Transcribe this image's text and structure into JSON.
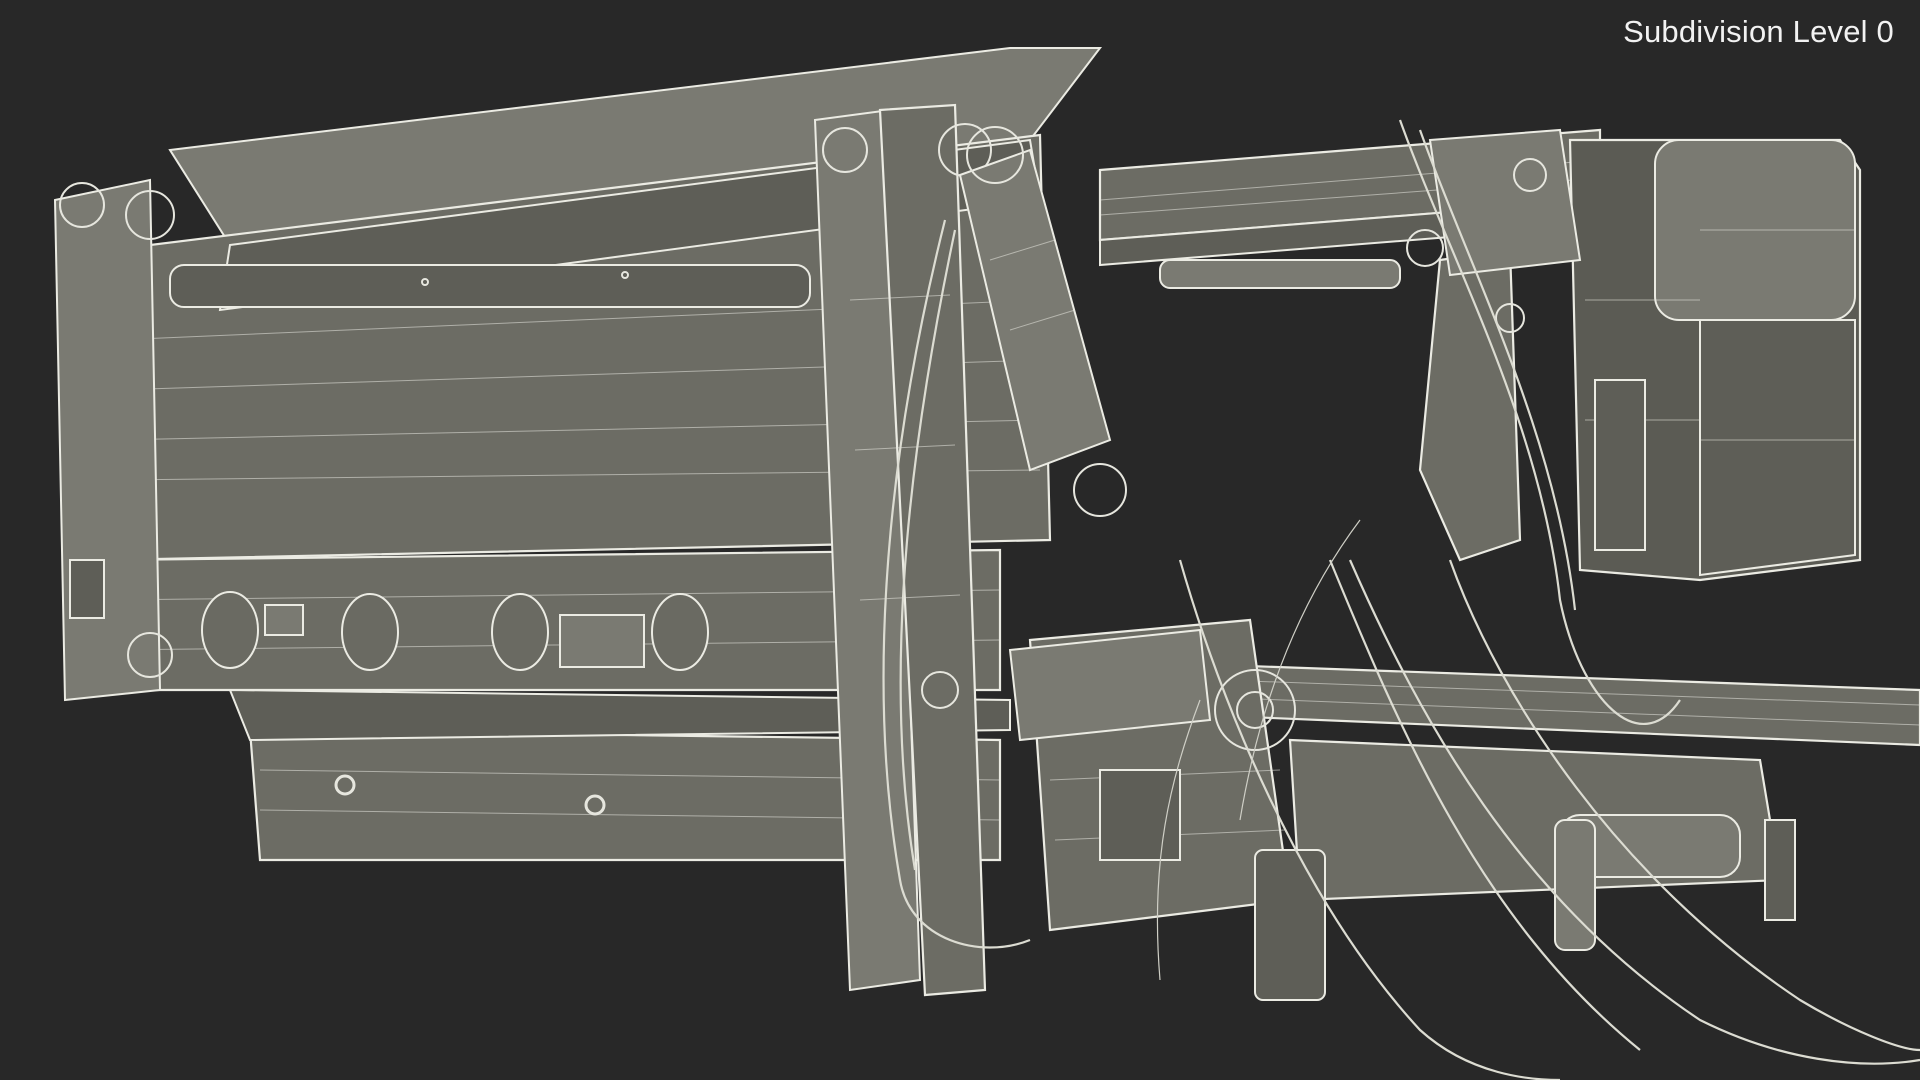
{
  "viewport": {
    "label": "Subdivision Level 0",
    "background_color": "#282828",
    "wire_color": "#e6e6de",
    "surface_color": "#6c6c64"
  },
  "model": {
    "render_style": "wireframe-over-shaded"
  }
}
